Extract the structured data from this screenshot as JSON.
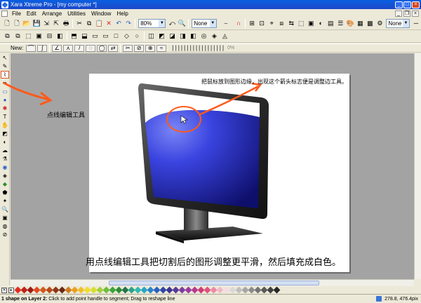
{
  "window": {
    "title": "Xara Xtreme Pro - [my computer *]"
  },
  "menu": {
    "items": [
      "File",
      "Edit",
      "Arrange",
      "Utilities",
      "Window",
      "Help"
    ]
  },
  "toolbar": {
    "zoom_value": "80%",
    "fill_value": "None",
    "line_value": "None"
  },
  "nodebar": {
    "new_label": "New:",
    "percent": "0%"
  },
  "canvas": {
    "annotation_top": "把鼠标放到图形边缘，出现这个箭头标志便是调整边工具。",
    "annotation_left": "点线编辑工具",
    "annotation_bottom": "用点线编辑工具把切割后的图形调整更平滑，然后填充成白色。"
  },
  "palette": {
    "colors": [
      "#e32b1f",
      "#c2201a",
      "#9e1a16",
      "#e3481f",
      "#d05a1d",
      "#b94a1b",
      "#8f3615",
      "#6b2a12",
      "#d47a20",
      "#e8a11d",
      "#eec12a",
      "#f2dc2e",
      "#d7df2c",
      "#a6cf38",
      "#6cbf3c",
      "#3ea63a",
      "#2e8c36",
      "#24744a",
      "#2aa38a",
      "#30b8b0",
      "#28a6c7",
      "#2a84c9",
      "#2a5fc0",
      "#2f47a8",
      "#3a3690",
      "#5a3a98",
      "#7a3fa0",
      "#9a3aa0",
      "#b83a8e",
      "#cf3c78",
      "#e0527c",
      "#ee8aa6",
      "#f2b7c9",
      "#f5dbe3",
      "#d9d9d9",
      "#bfbfbf",
      "#a6a6a6",
      "#8c8c8c",
      "#737373",
      "#595959",
      "#404040",
      "#262626"
    ]
  },
  "status": {
    "shape_info": "1 shape on Layer 2:",
    "hint": " Click to add point handle to segment; Drag to reshape line",
    "coords": "278.8, 476.4pix"
  }
}
